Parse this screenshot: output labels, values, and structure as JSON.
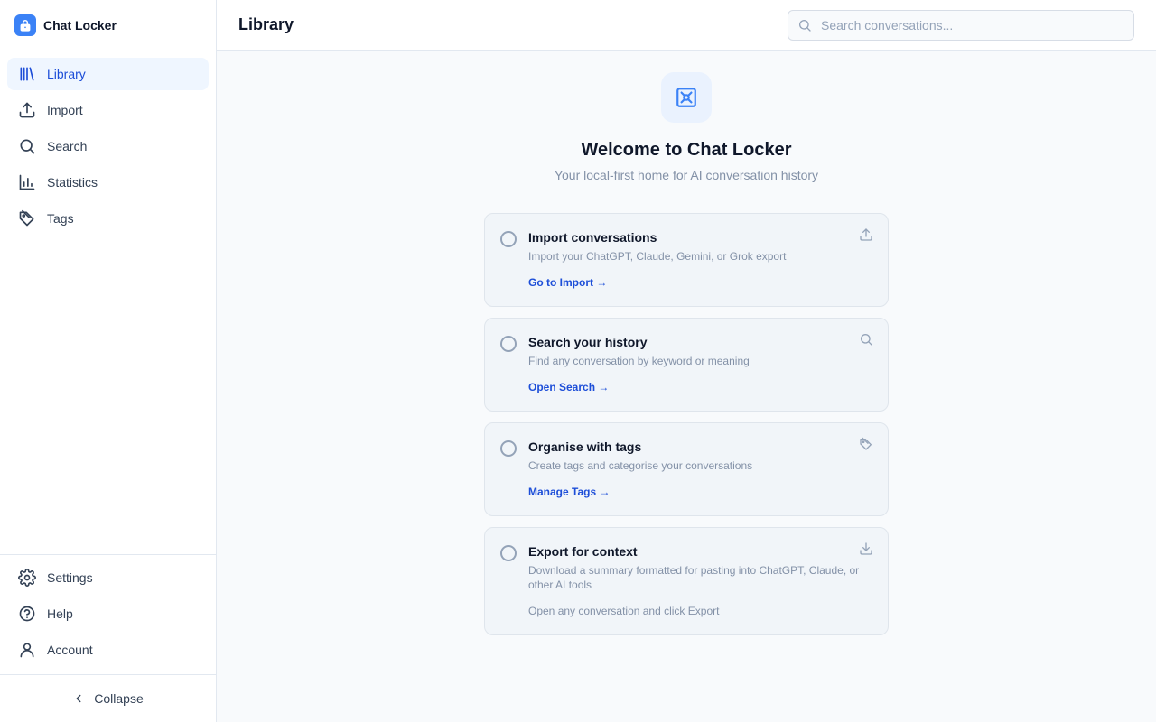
{
  "app": {
    "name": "Chat Locker"
  },
  "sidebar": {
    "items": [
      {
        "label": "Library",
        "icon": "library-icon",
        "active": true
      },
      {
        "label": "Import",
        "icon": "upload-icon"
      },
      {
        "label": "Search",
        "icon": "search-icon"
      },
      {
        "label": "Statistics",
        "icon": "bar-chart-icon"
      },
      {
        "label": "Tags",
        "icon": "tag-icon"
      }
    ],
    "bottom_items": [
      {
        "label": "Settings",
        "icon": "gear-icon"
      },
      {
        "label": "Help",
        "icon": "help-circle-icon"
      },
      {
        "label": "Account",
        "icon": "user-icon"
      }
    ],
    "collapse_label": "Collapse"
  },
  "header": {
    "title": "Library",
    "search_placeholder": "Search conversations..."
  },
  "welcome": {
    "title": "Welcome to Chat Locker",
    "subtitle": "Your local-first home for AI conversation history"
  },
  "cards": [
    {
      "title": "Import conversations",
      "desc": "Import your ChatGPT, Claude, Gemini, or Grok export",
      "action": "Go to Import →",
      "icon": "upload-icon"
    },
    {
      "title": "Search your history",
      "desc": "Find any conversation by keyword or meaning",
      "action": "Open Search →",
      "icon": "search-icon"
    },
    {
      "title": "Organise with tags",
      "desc": "Create tags and categorise your conversations",
      "action": "Manage Tags →",
      "icon": "tag-icon"
    },
    {
      "title": "Export for context",
      "desc": "Download a summary formatted for pasting into ChatGPT, Claude, or other AI tools",
      "hint": "Open any conversation and click Export",
      "icon": "download-icon"
    }
  ],
  "colors": {
    "accent": "#1d4ed8",
    "brand": "#3b82f6",
    "active_bg": "#eff6ff"
  }
}
